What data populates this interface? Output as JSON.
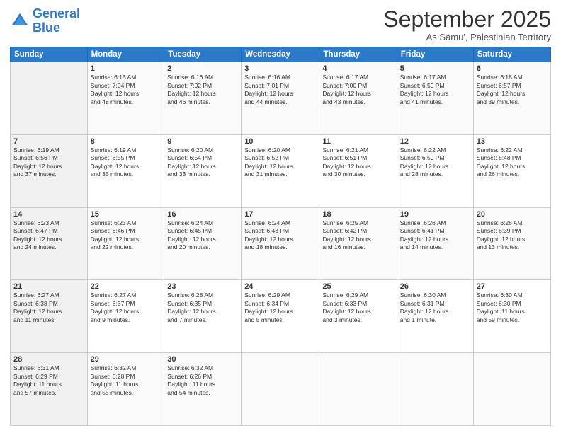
{
  "logo": {
    "line1": "General",
    "line2": "Blue"
  },
  "header": {
    "month": "September 2025",
    "location": "As Samu', Palestinian Territory"
  },
  "days": [
    "Sunday",
    "Monday",
    "Tuesday",
    "Wednesday",
    "Thursday",
    "Friday",
    "Saturday"
  ],
  "weeks": [
    [
      {
        "day": "",
        "content": ""
      },
      {
        "day": "1",
        "content": "Sunrise: 6:15 AM\nSunset: 7:04 PM\nDaylight: 12 hours\nand 48 minutes."
      },
      {
        "day": "2",
        "content": "Sunrise: 6:16 AM\nSunset: 7:02 PM\nDaylight: 12 hours\nand 46 minutes."
      },
      {
        "day": "3",
        "content": "Sunrise: 6:16 AM\nSunset: 7:01 PM\nDaylight: 12 hours\nand 44 minutes."
      },
      {
        "day": "4",
        "content": "Sunrise: 6:17 AM\nSunset: 7:00 PM\nDaylight: 12 hours\nand 43 minutes."
      },
      {
        "day": "5",
        "content": "Sunrise: 6:17 AM\nSunset: 6:59 PM\nDaylight: 12 hours\nand 41 minutes."
      },
      {
        "day": "6",
        "content": "Sunrise: 6:18 AM\nSunset: 6:57 PM\nDaylight: 12 hours\nand 39 minutes."
      }
    ],
    [
      {
        "day": "7",
        "content": "Sunrise: 6:19 AM\nSunset: 6:56 PM\nDaylight: 12 hours\nand 37 minutes."
      },
      {
        "day": "8",
        "content": "Sunrise: 6:19 AM\nSunset: 6:55 PM\nDaylight: 12 hours\nand 35 minutes."
      },
      {
        "day": "9",
        "content": "Sunrise: 6:20 AM\nSunset: 6:54 PM\nDaylight: 12 hours\nand 33 minutes."
      },
      {
        "day": "10",
        "content": "Sunrise: 6:20 AM\nSunset: 6:52 PM\nDaylight: 12 hours\nand 31 minutes."
      },
      {
        "day": "11",
        "content": "Sunrise: 6:21 AM\nSunset: 6:51 PM\nDaylight: 12 hours\nand 30 minutes."
      },
      {
        "day": "12",
        "content": "Sunrise: 6:22 AM\nSunset: 6:50 PM\nDaylight: 12 hours\nand 28 minutes."
      },
      {
        "day": "13",
        "content": "Sunrise: 6:22 AM\nSunset: 6:48 PM\nDaylight: 12 hours\nand 26 minutes."
      }
    ],
    [
      {
        "day": "14",
        "content": "Sunrise: 6:23 AM\nSunset: 6:47 PM\nDaylight: 12 hours\nand 24 minutes."
      },
      {
        "day": "15",
        "content": "Sunrise: 6:23 AM\nSunset: 6:46 PM\nDaylight: 12 hours\nand 22 minutes."
      },
      {
        "day": "16",
        "content": "Sunrise: 6:24 AM\nSunset: 6:45 PM\nDaylight: 12 hours\nand 20 minutes."
      },
      {
        "day": "17",
        "content": "Sunrise: 6:24 AM\nSunset: 6:43 PM\nDaylight: 12 hours\nand 18 minutes."
      },
      {
        "day": "18",
        "content": "Sunrise: 6:25 AM\nSunset: 6:42 PM\nDaylight: 12 hours\nand 16 minutes."
      },
      {
        "day": "19",
        "content": "Sunrise: 6:26 AM\nSunset: 6:41 PM\nDaylight: 12 hours\nand 14 minutes."
      },
      {
        "day": "20",
        "content": "Sunrise: 6:26 AM\nSunset: 6:39 PM\nDaylight: 12 hours\nand 13 minutes."
      }
    ],
    [
      {
        "day": "21",
        "content": "Sunrise: 6:27 AM\nSunset: 6:38 PM\nDaylight: 12 hours\nand 11 minutes."
      },
      {
        "day": "22",
        "content": "Sunrise: 6:27 AM\nSunset: 6:37 PM\nDaylight: 12 hours\nand 9 minutes."
      },
      {
        "day": "23",
        "content": "Sunrise: 6:28 AM\nSunset: 6:35 PM\nDaylight: 12 hours\nand 7 minutes."
      },
      {
        "day": "24",
        "content": "Sunrise: 6:29 AM\nSunset: 6:34 PM\nDaylight: 12 hours\nand 5 minutes."
      },
      {
        "day": "25",
        "content": "Sunrise: 6:29 AM\nSunset: 6:33 PM\nDaylight: 12 hours\nand 3 minutes."
      },
      {
        "day": "26",
        "content": "Sunrise: 6:30 AM\nSunset: 6:31 PM\nDaylight: 12 hours\nand 1 minute."
      },
      {
        "day": "27",
        "content": "Sunrise: 6:30 AM\nSunset: 6:30 PM\nDaylight: 11 hours\nand 59 minutes."
      }
    ],
    [
      {
        "day": "28",
        "content": "Sunrise: 6:31 AM\nSunset: 6:29 PM\nDaylight: 11 hours\nand 57 minutes."
      },
      {
        "day": "29",
        "content": "Sunrise: 6:32 AM\nSunset: 6:28 PM\nDaylight: 11 hours\nand 55 minutes."
      },
      {
        "day": "30",
        "content": "Sunrise: 6:32 AM\nSunset: 6:26 PM\nDaylight: 11 hours\nand 54 minutes."
      },
      {
        "day": "",
        "content": ""
      },
      {
        "day": "",
        "content": ""
      },
      {
        "day": "",
        "content": ""
      },
      {
        "day": "",
        "content": ""
      }
    ]
  ]
}
